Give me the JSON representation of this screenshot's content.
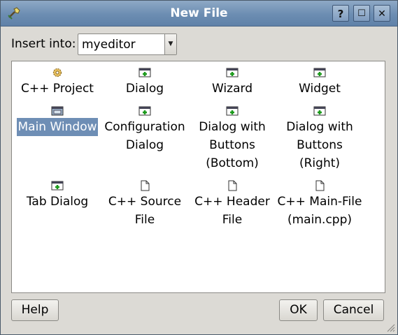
{
  "window": {
    "title": "New File"
  },
  "titlebar": {
    "help_btn": "?",
    "max_btn": "☐",
    "close_btn": "✕"
  },
  "insert": {
    "label": "Insert into:",
    "value": "myeditor"
  },
  "items": [
    {
      "label": "C++ Project",
      "icon": "gear-icon"
    },
    {
      "label": "Dialog",
      "icon": "dialog-icon"
    },
    {
      "label": "Wizard",
      "icon": "dialog-icon"
    },
    {
      "label": "Widget",
      "icon": "dialog-icon"
    },
    {
      "label": "Main Window",
      "icon": "window-icon",
      "selected": true
    },
    {
      "label": "Configuration Dialog",
      "icon": "dialog-icon"
    },
    {
      "label": "Dialog with Buttons (Bottom)",
      "icon": "dialog-icon"
    },
    {
      "label": "Dialog with Buttons (Right)",
      "icon": "dialog-icon"
    },
    {
      "label": "Tab Dialog",
      "icon": "dialog-icon"
    },
    {
      "label": "C++ Source File",
      "icon": "file-icon"
    },
    {
      "label": "C++ Header File",
      "icon": "file-icon"
    },
    {
      "label": "C++ Main-File (main.cpp)",
      "icon": "file-icon"
    }
  ],
  "buttons": {
    "help": "Help",
    "ok": "OK",
    "cancel": "Cancel"
  },
  "colors": {
    "titlebar": "#6c8db2",
    "selection": "#6e8eb5",
    "dialog_bg": "#dcdad5"
  }
}
